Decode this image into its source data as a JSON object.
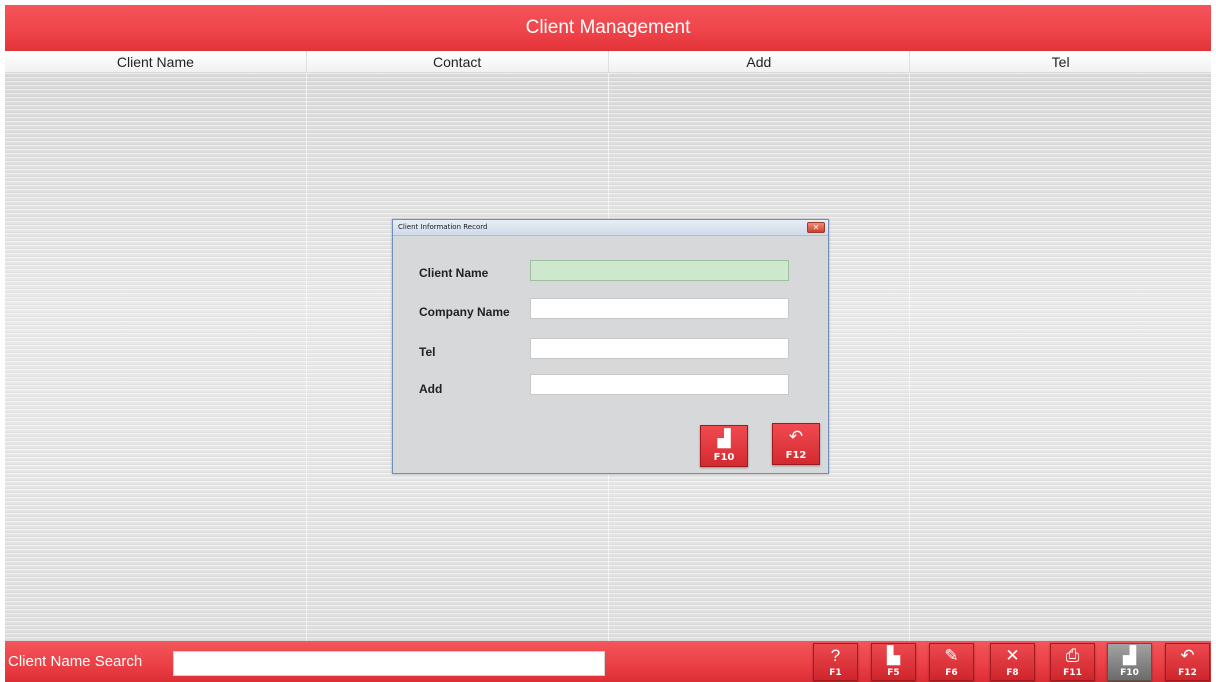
{
  "window": {
    "title": "Client Management"
  },
  "table": {
    "columns": [
      "Client Name",
      "Contact",
      "Add",
      "Tel"
    ]
  },
  "dialog": {
    "title": "Client Information Record",
    "close_glyph": "✕",
    "fields": [
      {
        "label": "Client Name",
        "value": ""
      },
      {
        "label": "Company Name",
        "value": ""
      },
      {
        "label": "Tel",
        "value": ""
      },
      {
        "label": "Add",
        "value": ""
      }
    ],
    "buttons": [
      {
        "icon": "save-icon",
        "glyph": "▟",
        "key": "F10"
      },
      {
        "icon": "return-icon",
        "glyph": "↶",
        "key": "F12"
      }
    ]
  },
  "bottom_bar": {
    "search_label": "Client Name Search",
    "search_value": "",
    "function_keys": [
      {
        "icon": "help-icon",
        "glyph": "?",
        "key": "F1"
      },
      {
        "icon": "add-record-icon",
        "glyph": "▙",
        "key": "F5"
      },
      {
        "icon": "edit-icon",
        "glyph": "✎",
        "key": "F6"
      },
      {
        "icon": "delete-icon",
        "glyph": "✕",
        "key": "F8"
      },
      {
        "icon": "print-icon",
        "glyph": "⎙",
        "key": "F11"
      },
      {
        "icon": "save-icon",
        "glyph": "▟",
        "key": "F10"
      },
      {
        "icon": "return-icon",
        "glyph": "↶",
        "key": "F12"
      }
    ]
  },
  "colors": {
    "accent_red": "#ef454b",
    "active_field": "#cde8cd",
    "disabled_button": "#8a8a8a"
  }
}
